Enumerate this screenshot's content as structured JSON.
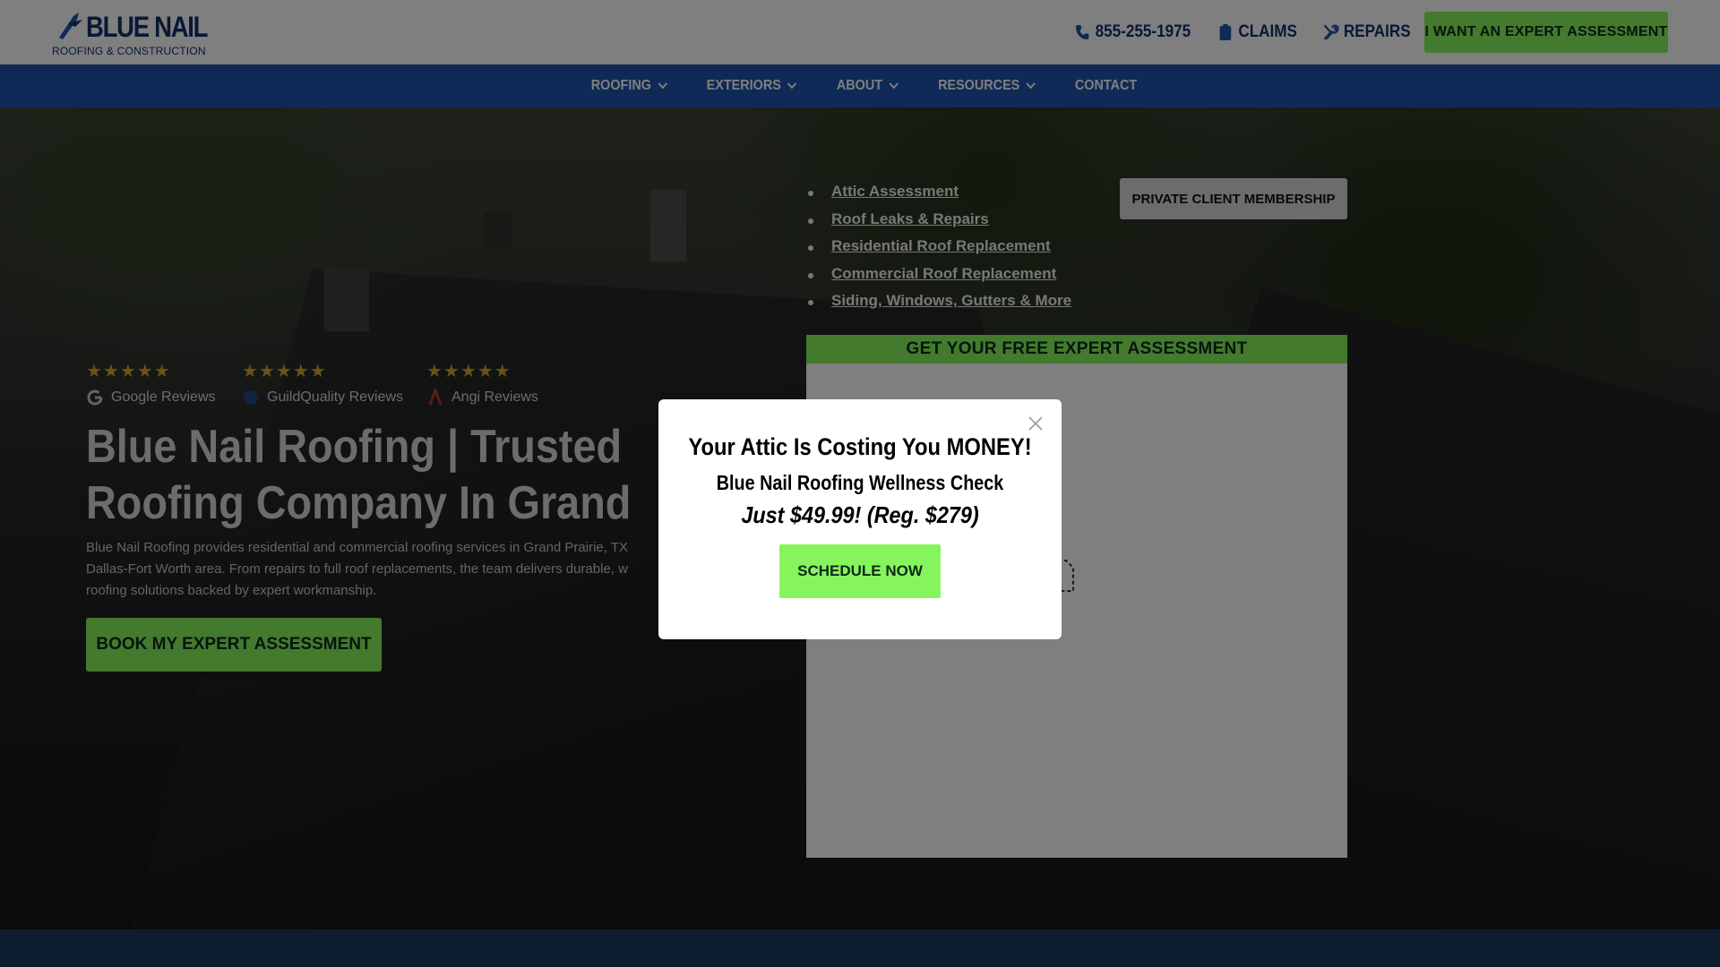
{
  "brand": {
    "name": "BLUE NAIL",
    "tagline": "ROOFING & CONSTRUCTION",
    "primary_color": "#1f55ad",
    "navy_color": "#11306b",
    "accent_color": "#86f55c"
  },
  "header": {
    "phone": {
      "icon": "phone-icon",
      "label": "855-255-1975"
    },
    "claims": {
      "icon": "clipboard-icon",
      "label": "CLAIMS"
    },
    "repairs": {
      "icon": "tools-icon",
      "label": "REPAIRS"
    },
    "cta_label": "I WANT AN EXPERT ASSESSMENT"
  },
  "nav": {
    "items": [
      {
        "label": "ROOFING",
        "has_dropdown": true
      },
      {
        "label": "EXTERIORS",
        "has_dropdown": true
      },
      {
        "label": "ABOUT",
        "has_dropdown": true
      },
      {
        "label": "RESOURCES",
        "has_dropdown": true
      },
      {
        "label": "CONTACT",
        "has_dropdown": false
      }
    ]
  },
  "hero": {
    "reviews": [
      {
        "stars": "★★★★★",
        "label": "Google Reviews",
        "icon": "google-icon"
      },
      {
        "stars": "★★★★★",
        "label": "GuildQuality Reviews",
        "icon": "guildquality-icon"
      },
      {
        "stars": "★★★★★",
        "label": "Angi Reviews",
        "icon": "angi-icon"
      }
    ],
    "title_line1": "Blue Nail Roofing | Trusted",
    "title_line2": "Roofing Company In Grand P",
    "description_lines": [
      "Blue Nail Roofing provides residential and commercial roofing services in Grand Prairie, TX",
      "Dallas-Fort Worth area. From repairs to full roof replacements, the team delivers durable, w",
      "roofing solutions backed by expert workmanship."
    ],
    "cta_label": "BOOK MY EXPERT ASSESSMENT",
    "services": [
      "Attic Assessment",
      "Roof Leaks & Repairs",
      "Residential Roof Replacement",
      "Commercial Roof Replacement",
      "Siding, Windows, Gutters & More"
    ],
    "private_client_label": "PRIVATE CLIENT MEMBERSHIP",
    "form_title": "GET YOUR FREE EXPERT ASSESSMENT"
  },
  "popup": {
    "title": "Your Attic Is Costing You MONEY!",
    "subtitle": "Blue Nail Roofing Wellness Check",
    "price": "Just $49.99! (Reg. $279)",
    "cta_label": "SCHEDULE NOW",
    "close_icon": "close-icon"
  }
}
